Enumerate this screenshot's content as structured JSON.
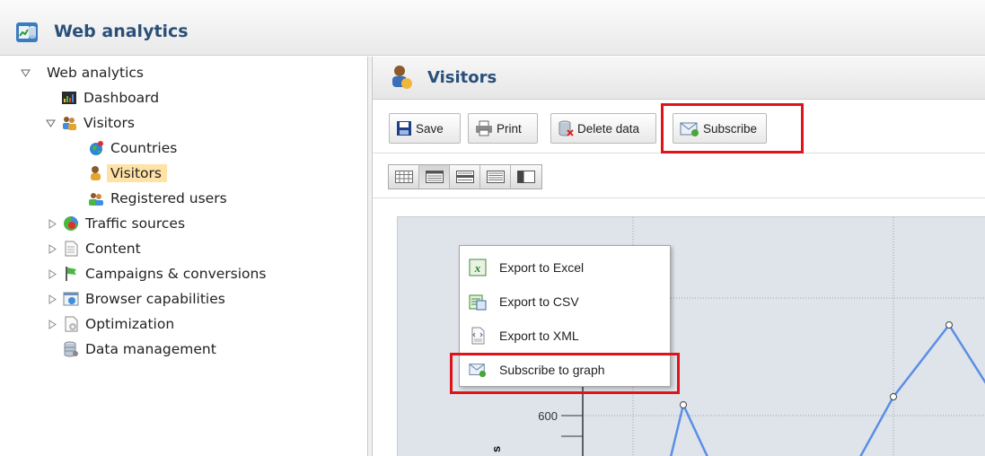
{
  "app": {
    "title": "Web analytics"
  },
  "sidebar": {
    "root": "Web analytics",
    "items": [
      {
        "label": "Dashboard"
      },
      {
        "label": "Visitors"
      },
      {
        "label": "Countries"
      },
      {
        "label": "Visitors"
      },
      {
        "label": "Registered users"
      },
      {
        "label": "Traffic sources"
      },
      {
        "label": "Content"
      },
      {
        "label": "Campaigns & conversions"
      },
      {
        "label": "Browser capabilities"
      },
      {
        "label": "Optimization"
      },
      {
        "label": "Data management"
      }
    ]
  },
  "main": {
    "title": "Visitors"
  },
  "toolbar": {
    "save_label": "Save",
    "print_label": "Print",
    "delete_label": "Delete data",
    "subscribe_label": "Subscribe"
  },
  "context_menu": {
    "items": [
      {
        "label": "Export to Excel"
      },
      {
        "label": "Export to CSV"
      },
      {
        "label": "Export to XML"
      },
      {
        "label": "Subscribe to graph"
      }
    ]
  },
  "chart": {
    "y_tick": "600",
    "axis_label_partial": "s"
  },
  "colors": {
    "highlight": "#e0121a",
    "selected": "#ffe2a6",
    "title_blue": "#2a4f79",
    "series_line": "#5b8ee6"
  }
}
